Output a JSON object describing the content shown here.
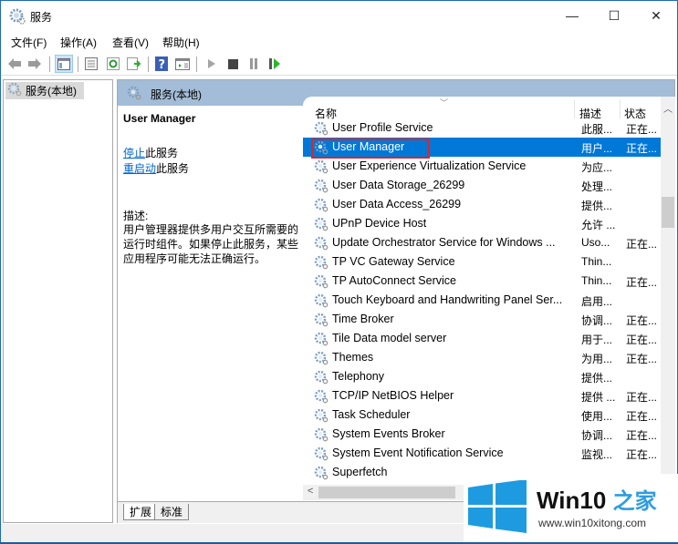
{
  "window": {
    "title": "服务",
    "controls": {
      "minimize": "—",
      "maximize": "☐",
      "close": "✕"
    }
  },
  "menu": [
    {
      "label": "文件(F)"
    },
    {
      "label": "操作(A)"
    },
    {
      "label": "查看(V)"
    },
    {
      "label": "帮助(H)"
    }
  ],
  "toolbar": [
    {
      "name": "back-icon"
    },
    {
      "name": "forward-icon"
    },
    {
      "name": "show-console-tree-icon"
    },
    {
      "name": "properties-icon"
    },
    {
      "name": "refresh-icon"
    },
    {
      "name": "export-list-icon"
    },
    {
      "name": "help-icon"
    },
    {
      "name": "show-action-pane-icon"
    },
    {
      "name": "start-service-icon"
    },
    {
      "name": "stop-service-icon"
    },
    {
      "name": "pause-service-icon"
    },
    {
      "name": "restart-service-icon"
    }
  ],
  "tree": {
    "item": "服务(本地)"
  },
  "pane_header": "服务(本地)",
  "detail": {
    "service_name": "User Manager",
    "stop_link": "停止",
    "stop_suffix": "此服务",
    "restart_link": "重启动",
    "restart_suffix": "此服务",
    "desc_label": "描述:",
    "description": "用户管理器提供多用户交互所需要的运行时组件。如果停止此服务，某些应用程序可能无法正确运行。"
  },
  "list": {
    "columns": {
      "name": "名称",
      "desc": "描述",
      "state": "状态"
    },
    "selected_index": 1,
    "rows": [
      {
        "name": "User Profile Service",
        "desc": "此服...",
        "state": "正在..."
      },
      {
        "name": "User Manager",
        "desc": "用户...",
        "state": "正在..."
      },
      {
        "name": "User Experience Virtualization Service",
        "desc": "为应...",
        "state": ""
      },
      {
        "name": "User Data Storage_26299",
        "desc": "处理...",
        "state": ""
      },
      {
        "name": "User Data Access_26299",
        "desc": "提供...",
        "state": ""
      },
      {
        "name": "UPnP Device Host",
        "desc": "允许 ...",
        "state": ""
      },
      {
        "name": "Update Orchestrator Service for Windows ...",
        "desc": "Uso...",
        "state": "正在..."
      },
      {
        "name": "TP VC Gateway Service",
        "desc": "Thin...",
        "state": ""
      },
      {
        "name": "TP AutoConnect Service",
        "desc": "Thin...",
        "state": "正在..."
      },
      {
        "name": "Touch Keyboard and Handwriting Panel Ser...",
        "desc": "启用...",
        "state": ""
      },
      {
        "name": "Time Broker",
        "desc": "协调...",
        "state": "正在..."
      },
      {
        "name": "Tile Data model server",
        "desc": "用于...",
        "state": "正在..."
      },
      {
        "name": "Themes",
        "desc": "为用...",
        "state": "正在..."
      },
      {
        "name": "Telephony",
        "desc": "提供...",
        "state": ""
      },
      {
        "name": "TCP/IP NetBIOS Helper",
        "desc": "提供 ...",
        "state": "正在..."
      },
      {
        "name": "Task Scheduler",
        "desc": "使用...",
        "state": "正在..."
      },
      {
        "name": "System Events Broker",
        "desc": "协调...",
        "state": "正在..."
      },
      {
        "name": "System Event Notification Service",
        "desc": "监视...",
        "state": "正在..."
      },
      {
        "name": "Superfetch",
        "desc": "",
        "state": ""
      }
    ]
  },
  "tabs": [
    {
      "label": "扩展",
      "active": true
    },
    {
      "label": "标准",
      "active": false
    }
  ],
  "watermark": {
    "brand": "Win10",
    "brand_cn": "之家",
    "url": "www.win10xitong.com",
    "logo_color": "#1e9be0"
  }
}
